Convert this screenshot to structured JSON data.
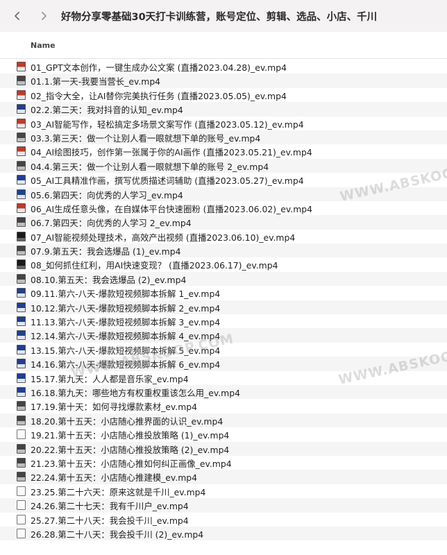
{
  "window": {
    "title": "好物分享零基础30天打卡训练营，账号定位、剪辑、选品、小店、千川"
  },
  "column_header": {
    "name": "Name"
  },
  "files": [
    {
      "name": "01_GPT文本创作，一键生成办公文案 (直播2023.04.28)_ev.mp4",
      "icon": "red"
    },
    {
      "name": "01.1.第一天-我要当营长_ev.mp4",
      "icon": "gray"
    },
    {
      "name": "02_指令大全，让AI替你完美执行任务 (直播2023.05.05)_ev.mp4",
      "icon": "red"
    },
    {
      "name": "02.2.第二天：我对抖音的认知_ev.mp4",
      "icon": "blue"
    },
    {
      "name": "03_AI智能写作，轻松搞定多场景文案写作 (直播2023.05.12)_ev.mp4",
      "icon": "red"
    },
    {
      "name": "03.3.第三天：做一个让别人看一眼就想下单的账号_ev.mp4",
      "icon": "gray"
    },
    {
      "name": "04_AI绘图技巧，创作第一张属于你的AI画作 (直播2023.05.21)_ev.mp4",
      "icon": "red"
    },
    {
      "name": "04.4.第三天：做一个让别人看一眼就想下单的账号 2_ev.mp4",
      "icon": "gray"
    },
    {
      "name": "05_AI工具精准作画，撰写优质描述词辅助 (直播2023.05.27)_ev.mp4",
      "icon": "blue"
    },
    {
      "name": "05.6.第四天：向优秀的人学习_ev.mp4",
      "icon": "blue"
    },
    {
      "name": "06_AI生成任意头像，在自媒体平台快速圈粉 (直播2023.06.02)_ev.mp4",
      "icon": "red"
    },
    {
      "name": "06.7.第四天：向优秀的人学习 2_ev.mp4",
      "icon": "gray"
    },
    {
      "name": "07_AI智能视频处理技术，高效产出视频 (直播2023.06.10)_ev.mp4",
      "icon": "dark"
    },
    {
      "name": "07.9.第五天：我会选爆品 (1)_ev.mp4",
      "icon": "gray"
    },
    {
      "name": "08_如何抓住红利，用AI快速变现？ (直播2023.06.17)_ev.mp4",
      "icon": "dark"
    },
    {
      "name": "08.10.第五天：我会选爆品 (2)_ev.mp4",
      "icon": "gray"
    },
    {
      "name": "09.11.第六-八天-爆款短视频脚本拆解 1_ev.mp4",
      "icon": "blue"
    },
    {
      "name": "10.12.第六-八天-爆款短视频脚本拆解 2_ev.mp4",
      "icon": "blue"
    },
    {
      "name": "11.13.第六-八天-爆款短视频脚本拆解 3_ev.mp4",
      "icon": "blue"
    },
    {
      "name": "12.14.第六-八天-爆款短视频脚本拆解 4_ev.mp4",
      "icon": "blue"
    },
    {
      "name": "13.15.第六-八天-爆款短视频脚本拆解 5_ev.mp4",
      "icon": "blue"
    },
    {
      "name": "14.16.第六-八天-爆款短视频脚本拆解 6_ev.mp4",
      "icon": "blue"
    },
    {
      "name": "15.17.第九天：人人都是音乐家_ev.mp4",
      "icon": "blue"
    },
    {
      "name": "16.18.第九天：哪些地方有权重权重该怎么用_ev.mp4",
      "icon": "blue"
    },
    {
      "name": "17.19.第十天：如何寻找爆款素材_ev.mp4",
      "icon": "gray"
    },
    {
      "name": "18.20.第十五天：小店随心推界面的认识_ev.mp4",
      "icon": "gray"
    },
    {
      "name": "19.21.第十五天：小店随心推投放策略 (1)_ev.mp4",
      "icon": "white"
    },
    {
      "name": "20.22.第十五天：小店随心推投放策略 (2)_ev.mp4",
      "icon": "gray"
    },
    {
      "name": "21.23.第十五天：小店随心推如何纠正画像_ev.mp4",
      "icon": "gray"
    },
    {
      "name": "22.24.第十五天：小店随心推建模_ev.mp4",
      "icon": "gray"
    },
    {
      "name": "23.25.第二十六天：原来这就是千川_ev.mp4",
      "icon": "white"
    },
    {
      "name": "24.26.第二十七天：我有千川户_ev.mp4",
      "icon": "white"
    },
    {
      "name": "25.27.第二十八天：我会投千川_ev.mp4",
      "icon": "white"
    },
    {
      "name": "26.28.第二十八天：我会投千川 (2)_ev.mp4",
      "icon": "white"
    }
  ],
  "watermarks": [
    "WWW.ABSKOOP",
    "WWW.ABSKOOP",
    "WWW.ABSKOOP.COM"
  ]
}
